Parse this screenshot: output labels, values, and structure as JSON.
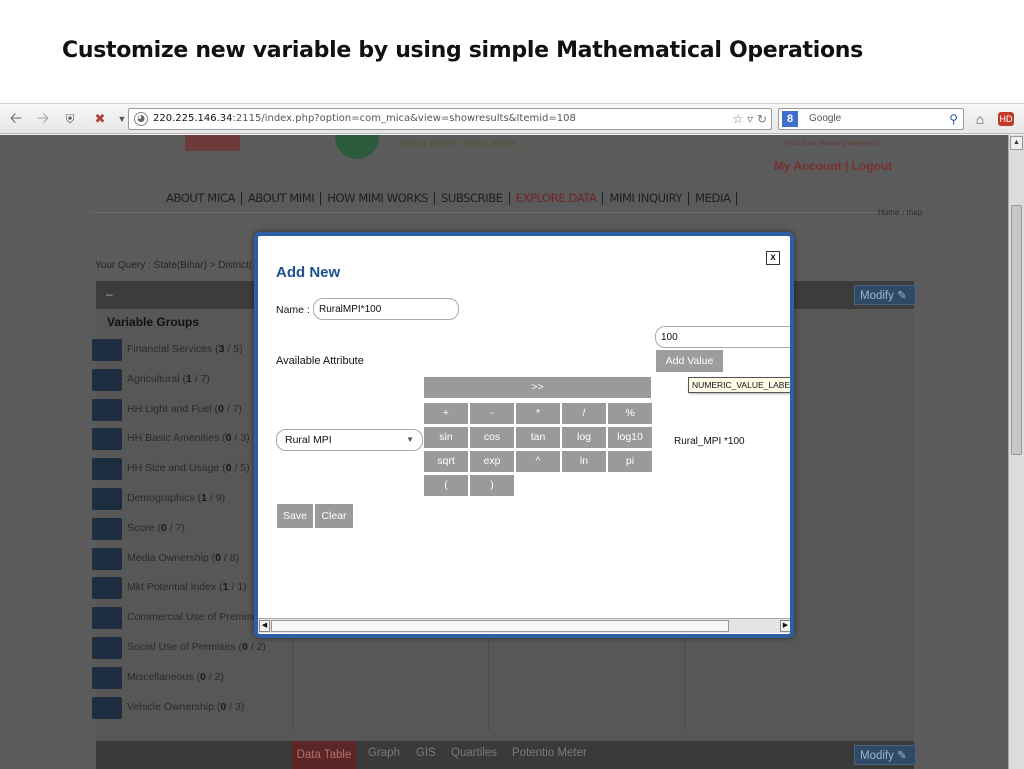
{
  "slide": {
    "title": "Customize new variable by using simple Mathematical Operations"
  },
  "browser": {
    "url_host": "220.225.146.34",
    "url_rest": ":2115/index.php?option=com_mica&view=showresults&Itemid=108",
    "search_placeholder": "Google",
    "icons": [
      "back-arrow",
      "forward-arrow",
      "shield",
      "bookmark",
      "history-dropdown",
      "globe",
      "star",
      "refresh",
      "search",
      "home",
      "addon"
    ]
  },
  "site": {
    "brand_tagline": "MICA Indian Marketing Intelligence",
    "account_links": "My Account | Logout",
    "nav": [
      "ABOUT MICA",
      "ABOUT MIMI",
      "HOW MIMI WORKS",
      "SUBSCRIBE",
      "EXPLORE DATA",
      "MIMI INQUIRY",
      "MEDIA"
    ],
    "nav_active": "EXPLORE DATA",
    "breadcrumb": "Home › map",
    "query": "Your Query : State(Bihar) > District(",
    "modify_label": "Modify",
    "variable_groups_title": "Variable Groups",
    "variable_groups": [
      {
        "name": "Financial Services",
        "selected": "3",
        "total": "5"
      },
      {
        "name": "Agricultural",
        "selected": "1",
        "total": "7"
      },
      {
        "name": "HH Light and Fuel",
        "selected": "0",
        "total": "7"
      },
      {
        "name": "HH Basic Amenities",
        "selected": "0",
        "total": "3"
      },
      {
        "name": "HH Size and Usage",
        "selected": "0",
        "total": "5"
      },
      {
        "name": "Demographics",
        "selected": "1",
        "total": "9"
      },
      {
        "name": "Score",
        "selected": "0",
        "total": "7"
      },
      {
        "name": "Media Ownership",
        "selected": "0",
        "total": "8"
      },
      {
        "name": "Mkt Potential Index",
        "selected": "1",
        "total": "1"
      },
      {
        "name": "Commercial Use of Premises",
        "selected": "",
        "total": ""
      },
      {
        "name": "Social Use of Premises",
        "selected": "0",
        "total": "2"
      },
      {
        "name": "Miscellaneous",
        "selected": "0",
        "total": "2"
      },
      {
        "name": "Vehicle Ownership",
        "selected": "0",
        "total": "3"
      }
    ],
    "bottom_tabs": [
      "Data Table",
      "Graph",
      "GIS",
      "Quartiles",
      "Potentio Meter"
    ]
  },
  "modal": {
    "title": "Add New",
    "close_label": "x",
    "name_label": "Name :",
    "name_value": "RuralMPI*100",
    "value_input": "100",
    "add_value_label": "Add Value",
    "tooltip": "NUMERIC_VALUE_LABEL",
    "available_attribute_label": "Available Attribute",
    "attribute_selected": "Rural MPI",
    "calc_top": ">>",
    "calc_rows": [
      [
        "+",
        "-",
        "*",
        "/",
        "%"
      ],
      [
        "sin",
        "cos",
        "tan",
        "log",
        "log10"
      ],
      [
        "sqrt",
        "exp",
        "^",
        "ln",
        "pi"
      ],
      [
        "(",
        ")"
      ]
    ],
    "expression": "Rural_MPI *100",
    "save_label": "Save",
    "clear_label": "Clear"
  }
}
